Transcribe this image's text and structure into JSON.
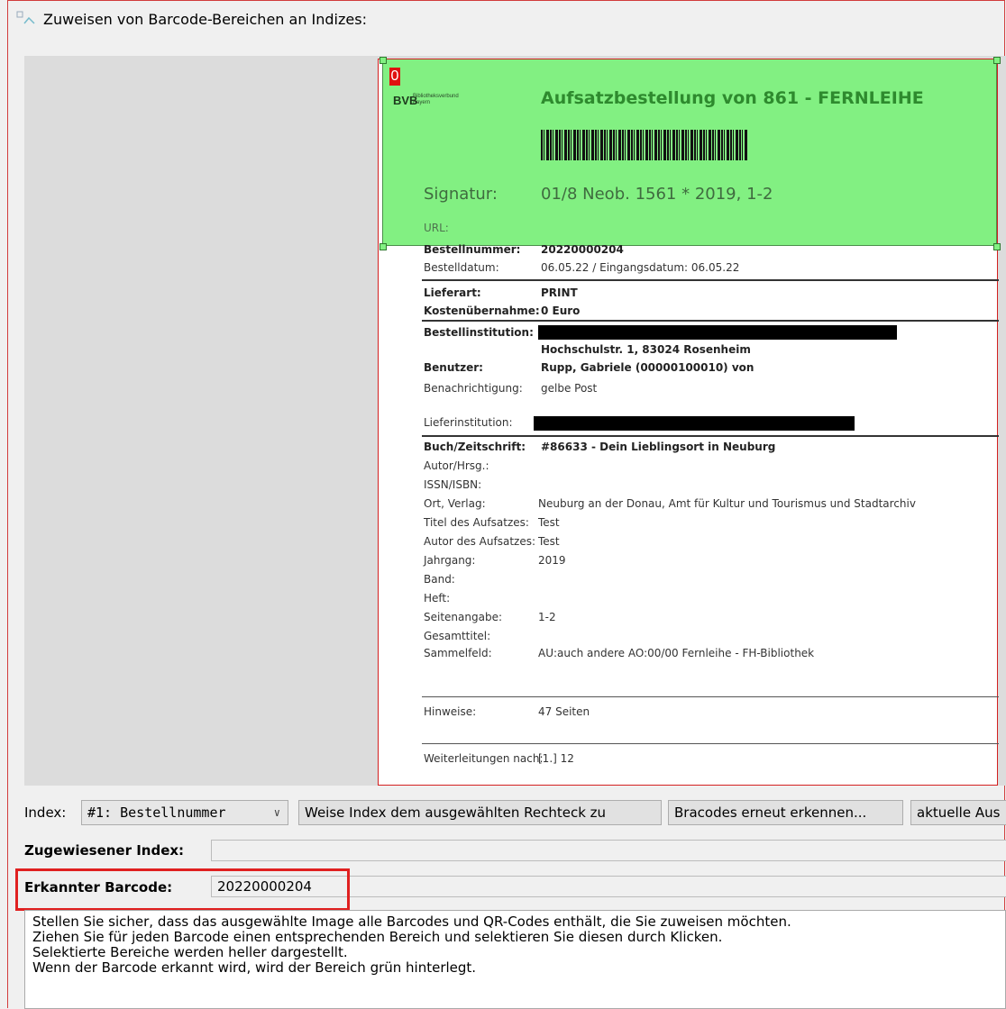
{
  "window": {
    "title": "Zuweisen von Barcode-Bereichen an Indizes:"
  },
  "document": {
    "selection_number": "0",
    "logo_text": "BVB",
    "logo_subtext": "Bibliotheksverbund Bayern",
    "heading": "Aufsatzbestellung von 861 - FERNLEIHE",
    "signatur_label": "Signatur:",
    "signatur_value": "01/8 Neob. 1561 * 2019, 1-2",
    "url_label": "URL:",
    "fields": [
      {
        "label": "Bestellnummer:",
        "value": "20220000204"
      },
      {
        "label": "Bestelldatum:",
        "value": "06.05.22  /  Eingangsdatum: 06.05.22"
      },
      {
        "label": "Lieferart:",
        "value": "PRINT"
      },
      {
        "label": "Kostenübernahme:",
        "value": "0 Euro"
      },
      {
        "label": "Bestellinstitution:",
        "value": ""
      },
      {
        "label": "",
        "value": "Hochschulstr. 1, 83024 Rosenheim"
      },
      {
        "label": "Benutzer:",
        "value": "Rupp, Gabriele (00000100010) von"
      },
      {
        "label": "Benachrichtigung:",
        "value": "gelbe Post"
      },
      {
        "label": "Lieferinstitution:",
        "value": ""
      },
      {
        "label": "Buch/Zeitschrift:",
        "value": "#86633 - Dein Lieblingsort in Neuburg"
      },
      {
        "label": "Autor/Hrsg.:",
        "value": ""
      },
      {
        "label": "ISSN/ISBN:",
        "value": ""
      },
      {
        "label": "Ort, Verlag:",
        "value": "Neuburg an der Donau, Amt für Kultur und Tourismus und Stadtarchiv"
      },
      {
        "label": "Titel des Aufsatzes:",
        "value": "Test"
      },
      {
        "label": "Autor des Aufsatzes:",
        "value": "Test"
      },
      {
        "label": "Jahrgang:",
        "value": "2019"
      },
      {
        "label": "Band:",
        "value": ""
      },
      {
        "label": "Heft:",
        "value": ""
      },
      {
        "label": "Seitenangabe:",
        "value": "1-2"
      },
      {
        "label": "Gesamttitel:",
        "value": ""
      },
      {
        "label": "Sammelfeld:",
        "value": "AU:auch andere AO:00/00 Fernleihe - FH-Bibliothek"
      },
      {
        "label": "Hinweise:",
        "value": "47 Seiten"
      },
      {
        "label": "Weiterleitungen nach:",
        "value": "[1.] 12"
      }
    ]
  },
  "controls": {
    "index_label": "Index:",
    "index_selected": "#1: Bestellnummer",
    "assign_button": "Weise Index dem ausgewählten Rechteck zu",
    "redetect_button": "Bracodes erneut erkennen...",
    "current_button": "aktuelle Aus",
    "assigned_index_label": "Zugewiesener Index:",
    "assigned_index_value": "",
    "detected_barcode_label": "Erkannter Barcode:",
    "detected_barcode_value": "20220000204"
  },
  "instructions": [
    "Stellen Sie sicher, dass das ausgewählte Image alle Barcodes und QR-Codes enthält, die Sie zuweisen möchten.",
    "Ziehen Sie für jeden Barcode einen entsprechenden Bereich und selektieren Sie diesen durch Klicken.",
    "Selektierte Bereiche werden heller dargestellt.",
    "Wenn der Barcode erkannt wird, wird der Bereich grün hinterlegt."
  ],
  "colors": {
    "selection_fill": "#82f082",
    "highlight_border": "#e02020",
    "heading_green": "#2e8a2e"
  }
}
